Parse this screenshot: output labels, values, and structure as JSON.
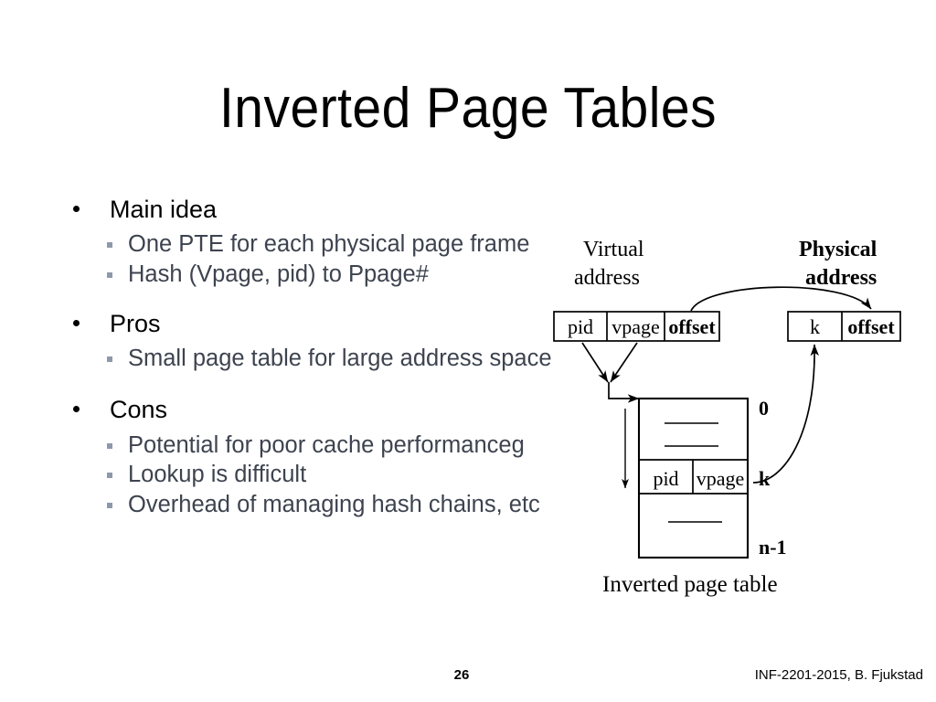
{
  "slide": {
    "title": "Inverted Page Tables",
    "page_number": "26",
    "credit": "INF-2201-2015, B. Fjukstad"
  },
  "content": {
    "sections": [
      {
        "heading": "Main idea",
        "items": [
          "One PTE for each physical page frame",
          "Hash (Vpage, pid) to Ppage#"
        ]
      },
      {
        "heading": "Pros",
        "items": [
          "Small page table for large address space"
        ]
      },
      {
        "heading": "Cons",
        "items": [
          "Potential for poor cache performanceg",
          "Lookup is difficult",
          "Overhead of managing hash chains, etc"
        ]
      }
    ]
  },
  "diagram": {
    "caption": "Inverted page table",
    "virtual_address": {
      "label_line1": "Virtual",
      "label_line2": "address",
      "fields": [
        "pid",
        "vpage",
        "offset"
      ]
    },
    "physical_address": {
      "label_line1": "Physical",
      "label_line2": "address",
      "fields": [
        "k",
        "offset"
      ]
    },
    "table": {
      "row_fields": [
        "pid",
        "vpage"
      ],
      "index_top": "0",
      "index_match": "k",
      "index_bottom": "n-1"
    }
  },
  "colors": {
    "title_text": "#000000",
    "level1_text": "#000000",
    "level2_text": "#3d434f",
    "level2_bullet": "#8d99ab",
    "diagram_stroke": "#000000",
    "background": "#ffffff"
  }
}
